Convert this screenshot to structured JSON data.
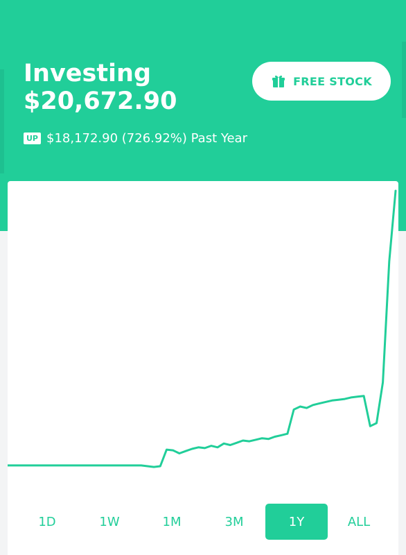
{
  "portfolio": {
    "title": "Investing",
    "value": "$20,672.90",
    "change_badge": "UP",
    "change_text": "$18,172.90 (726.92%) Past Year"
  },
  "free_stock_button": {
    "label": "FREE STOCK",
    "icon": "gift-icon"
  },
  "ranges": [
    {
      "label": "1D",
      "active": false
    },
    {
      "label": "1W",
      "active": false
    },
    {
      "label": "1M",
      "active": false
    },
    {
      "label": "3M",
      "active": false
    },
    {
      "label": "1Y",
      "active": true
    },
    {
      "label": "ALL",
      "active": false
    }
  ],
  "colors": {
    "accent": "#21ce99",
    "background": "#f3f4f5",
    "card": "#ffffff"
  },
  "chart_data": {
    "type": "line",
    "series": [
      {
        "values": [
          2500,
          2500,
          2500,
          2500,
          2500,
          2500,
          2500,
          2500,
          2500,
          2500,
          2500,
          2500,
          2500,
          2500,
          2500,
          2500,
          2500,
          2500,
          2500,
          2500,
          2500,
          2500,
          2450,
          2400,
          2450,
          3550,
          3500,
          3300,
          3450,
          3600,
          3700,
          3650,
          3800,
          3700,
          3950,
          3850,
          4000,
          4150,
          4100,
          4200,
          4300,
          4250,
          4400,
          4500,
          4600,
          6200,
          6400,
          6300,
          6500,
          6600,
          6700,
          6800,
          6850,
          6900,
          7000,
          7050,
          7100,
          5100,
          5300,
          8000,
          16000,
          20672.9
        ]
      }
    ]
  }
}
